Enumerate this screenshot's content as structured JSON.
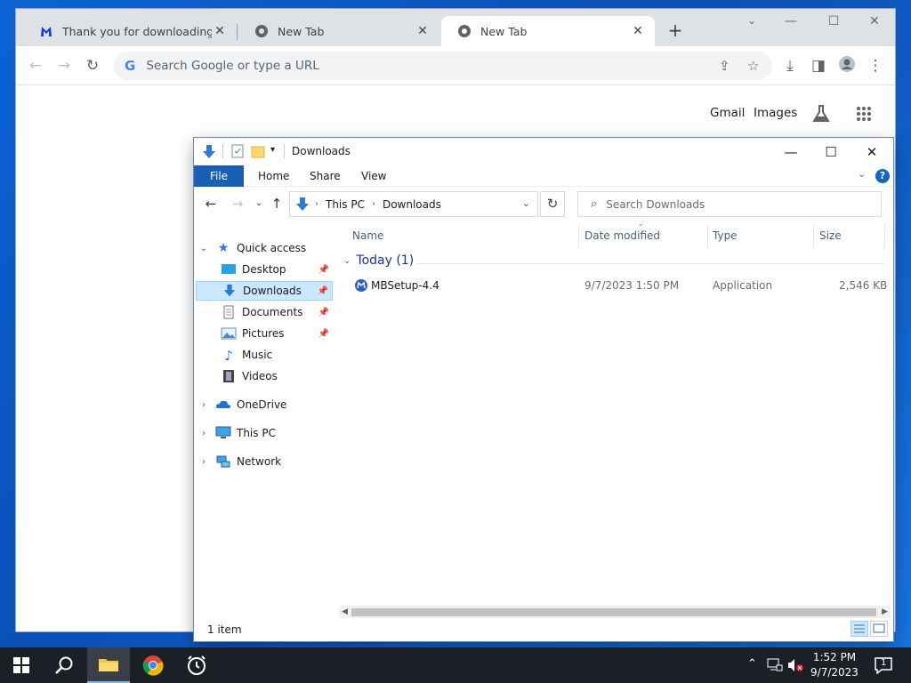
{
  "chrome": {
    "tabs": [
      {
        "title": "Thank you for downloading Malwarebytes",
        "icon": "malwarebytes-icon",
        "active": false
      },
      {
        "title": "New Tab",
        "icon": "chrome-icon",
        "active": false
      },
      {
        "title": "New Tab",
        "icon": "chrome-icon",
        "active": true
      }
    ],
    "omnibox_placeholder": "Search Google or type a URL",
    "content_links": {
      "gmail": "Gmail",
      "images": "Images"
    }
  },
  "explorer": {
    "title": "Downloads",
    "ribbon_tabs": [
      "File",
      "Home",
      "Share",
      "View"
    ],
    "help_label": "?",
    "address": {
      "segments": [
        "This PC",
        "Downloads"
      ]
    },
    "search_placeholder": "Search Downloads",
    "navpane": {
      "quick_access": "Quick access",
      "items": [
        {
          "label": "Desktop",
          "icon": "desktop-icon",
          "pinned": true
        },
        {
          "label": "Downloads",
          "icon": "downloads-icon",
          "pinned": true,
          "selected": true
        },
        {
          "label": "Documents",
          "icon": "documents-icon",
          "pinned": true
        },
        {
          "label": "Pictures",
          "icon": "pictures-icon",
          "pinned": true
        },
        {
          "label": "Music",
          "icon": "music-icon",
          "pinned": false
        },
        {
          "label": "Videos",
          "icon": "videos-icon",
          "pinned": false
        }
      ],
      "roots": [
        {
          "label": "OneDrive",
          "icon": "onedrive-icon"
        },
        {
          "label": "This PC",
          "icon": "this-pc-icon"
        },
        {
          "label": "Network",
          "icon": "network-icon"
        }
      ]
    },
    "columns": {
      "name": "Name",
      "date_modified": "Date modified",
      "type": "Type",
      "size": "Size"
    },
    "group_label": "Today (1)",
    "files": [
      {
        "name": "MBSetup-4.4",
        "date_modified": "9/7/2023 1:50 PM",
        "type": "Application",
        "size": "2,546 KB"
      }
    ],
    "status": "1 item"
  },
  "taskbar": {
    "time": "1:52 PM",
    "date": "9/7/2023",
    "notification_count": "1"
  }
}
